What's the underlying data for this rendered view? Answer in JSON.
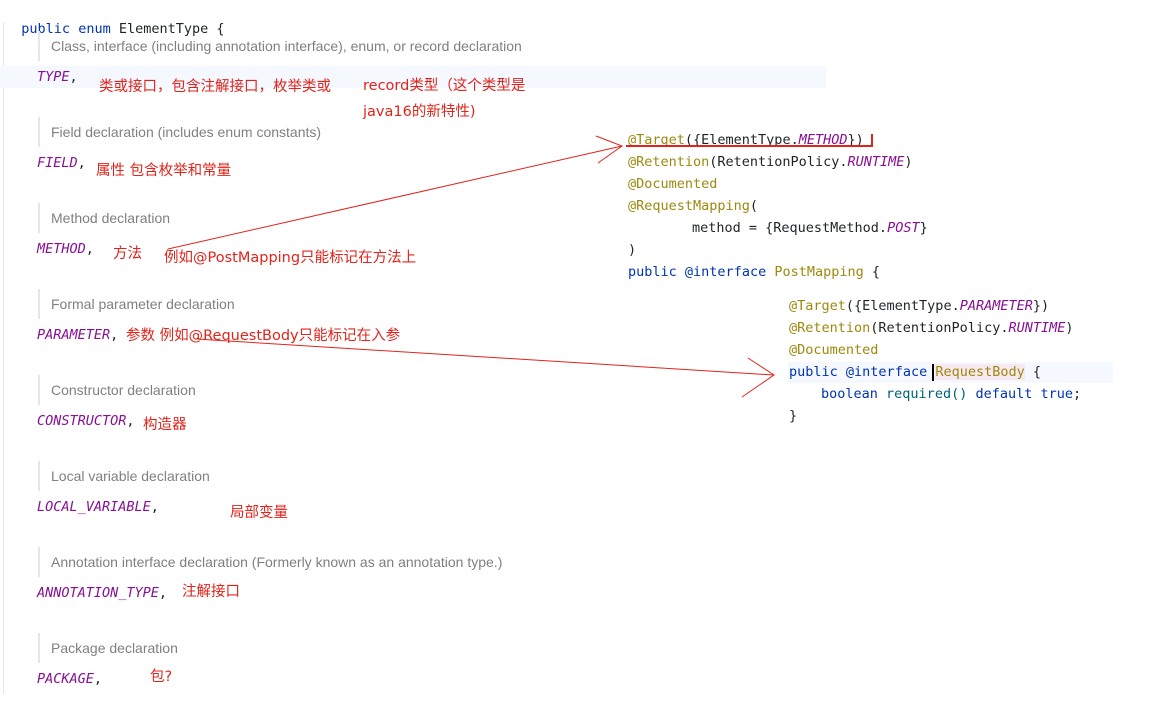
{
  "enum_header": {
    "kw1": "public",
    "kw2": "enum",
    "name": "ElementType",
    "brace": "{"
  },
  "entries": [
    {
      "doc": "Class, interface (including annotation interface), enum, or record declaration",
      "constant": "TYPE",
      "sep": ","
    },
    {
      "doc": "Field declaration (includes enum constants)",
      "constant": "FIELD",
      "sep": ","
    },
    {
      "doc": "Method declaration",
      "constant": "METHOD",
      "sep": ","
    },
    {
      "doc": "Formal parameter declaration",
      "constant": "PARAMETER",
      "sep": ","
    },
    {
      "doc": "Constructor declaration",
      "constant": "CONSTRUCTOR",
      "sep": ","
    },
    {
      "doc": "Local variable declaration",
      "constant": "LOCAL_VARIABLE",
      "sep": ","
    },
    {
      "doc": "Annotation interface declaration (Formerly known as an annotation type.)",
      "constant": "ANNOTATION_TYPE",
      "sep": ","
    },
    {
      "doc": "Package declaration",
      "constant": "PACKAGE",
      "sep": ","
    }
  ],
  "notes": {
    "type_a": "类或接口，包含注解接口，枚举类或",
    "type_b": "record类型（这个类型是",
    "type_c": "java16的新特性)",
    "field": "属性 包含枚举和常量",
    "method_a": "方法",
    "method_b": "例如@PostMapping只能标记在方法上",
    "parameter": "参数 例如@RequestBody只能标记在入参",
    "constructor": "构造器",
    "local_variable": "局部变量",
    "annotation_type": "注解接口",
    "package": "包?"
  },
  "post_mapping": {
    "target_anno": "@Target",
    "target_open": "({ElementType.",
    "target_val": "METHOD",
    "target_close": "})",
    "retention_anno": "@Retention",
    "retention_open": "(RetentionPolicy.",
    "retention_val": "RUNTIME",
    "retention_close": ")",
    "documented": "@Documented",
    "request_mapping": "@RequestMapping",
    "rm_open": "(",
    "method_key": "method = {RequestMethod.",
    "method_val": "POST",
    "method_close": "}",
    "close_paren": ")",
    "decl_public": "public",
    "decl_iface": "@interface",
    "decl_name": "PostMapping",
    "decl_brace": "{"
  },
  "request_body": {
    "target_anno": "@Target",
    "target_open": "({ElementType.",
    "target_val": "PARAMETER",
    "target_close": "})",
    "retention_anno": "@Retention",
    "retention_open": "(RetentionPolicy.",
    "retention_val": "RUNTIME",
    "retention_close": ")",
    "documented": "@Documented",
    "decl_public": "public",
    "decl_iface": "@interface",
    "decl_name": "RequestBody",
    "decl_brace": "{",
    "member_type": "boolean",
    "member_name": "required()",
    "member_default": "default",
    "member_value": "true",
    "member_semi": ";",
    "close_brace": "}"
  },
  "colors": {
    "keyword": "#0033b3",
    "enum_constant": "#871094",
    "annotation": "#9e880d",
    "doc_comment": "#808080",
    "note_red": "#e0241b"
  }
}
